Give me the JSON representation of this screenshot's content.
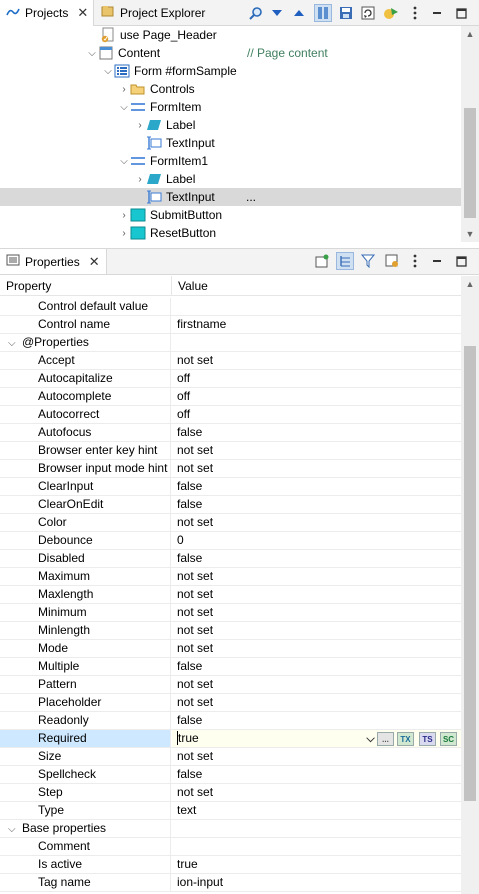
{
  "top_panel": {
    "tabs": [
      {
        "label": "Projects",
        "icon": "projects-icon"
      },
      {
        "label": "Project Explorer",
        "icon": "project-explorer-icon"
      }
    ],
    "tree": [
      {
        "label": "use Page_Header",
        "icon": "use-reference-icon",
        "twisty": "none"
      },
      {
        "label": "Content",
        "comment": "// Page content",
        "icon": "page-icon",
        "twisty": "expanded"
      },
      {
        "label": "Form #formSample",
        "icon": "form-icon",
        "twisty": "expanded"
      },
      {
        "label": "Controls",
        "icon": "folder-icon",
        "twisty": "collapsed"
      },
      {
        "label": "FormItem",
        "icon": "form-item-icon",
        "twisty": "expanded"
      },
      {
        "label": "Label",
        "icon": "label-icon",
        "twisty": "collapsed"
      },
      {
        "label": "TextInput",
        "icon": "text-input-icon",
        "twisty": "none"
      },
      {
        "label": "FormItem1",
        "icon": "form-item-icon",
        "twisty": "expanded"
      },
      {
        "label": "Label",
        "icon": "label-icon",
        "twisty": "collapsed"
      },
      {
        "label": "TextInput",
        "suffix": "...",
        "icon": "text-input-icon",
        "twisty": "none"
      },
      {
        "label": "SubmitButton",
        "icon": "button-icon",
        "twisty": "collapsed"
      },
      {
        "label": "ResetButton",
        "icon": "button-icon",
        "twisty": "collapsed"
      }
    ]
  },
  "properties_panel": {
    "tab_label": "Properties",
    "header": {
      "property": "Property",
      "value": "Value"
    },
    "rows": [
      {
        "name": "Control default value",
        "value": ""
      },
      {
        "name": "Control name",
        "value": "firstname"
      },
      {
        "name": "@Properties",
        "value": "",
        "group": true
      },
      {
        "name": "Accept",
        "value": "not set"
      },
      {
        "name": "Autocapitalize",
        "value": "off"
      },
      {
        "name": "Autocomplete",
        "value": "off"
      },
      {
        "name": "Autocorrect",
        "value": "off"
      },
      {
        "name": "Autofocus",
        "value": "false"
      },
      {
        "name": "Browser enter key hint",
        "value": "not set"
      },
      {
        "name": "Browser input mode hint",
        "value": "not set"
      },
      {
        "name": "ClearInput",
        "value": "false"
      },
      {
        "name": "ClearOnEdit",
        "value": "false"
      },
      {
        "name": "Color",
        "value": "not set"
      },
      {
        "name": "Debounce",
        "value": "0"
      },
      {
        "name": "Disabled",
        "value": "false"
      },
      {
        "name": "Maximum",
        "value": "not set"
      },
      {
        "name": "Maxlength",
        "value": "not set"
      },
      {
        "name": "Minimum",
        "value": "not set"
      },
      {
        "name": "Minlength",
        "value": "not set"
      },
      {
        "name": "Mode",
        "value": "not set"
      },
      {
        "name": "Multiple",
        "value": "false"
      },
      {
        "name": "Pattern",
        "value": "not set"
      },
      {
        "name": "Placeholder",
        "value": "not set"
      },
      {
        "name": "Readonly",
        "value": "false"
      },
      {
        "name": "Required",
        "value": "true",
        "selected": true
      },
      {
        "name": "Size",
        "value": "not set"
      },
      {
        "name": "Spellcheck",
        "value": "false"
      },
      {
        "name": "Step",
        "value": "not set"
      },
      {
        "name": "Type",
        "value": "text"
      },
      {
        "name": "Base properties",
        "value": "",
        "group": true
      },
      {
        "name": "Comment",
        "value": ""
      },
      {
        "name": "Is active",
        "value": "true"
      },
      {
        "name": "Tag name",
        "value": "ion-input"
      }
    ],
    "editor_buttons": {
      "ellipsis": "...",
      "tx": "TX",
      "ts": "TS",
      "sc": "SC"
    }
  },
  "colors": {
    "selected_tree_row": "#d9d9d9",
    "selected_property_name": "#cde8ff",
    "comment_green": "#3f7f5f",
    "tab_bar": "#f3f3f3"
  }
}
